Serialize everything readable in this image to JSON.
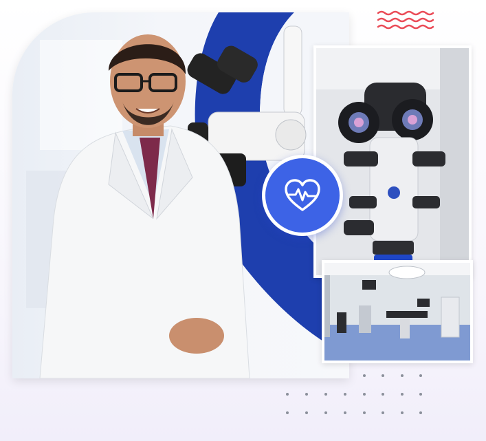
{
  "scene": {
    "subject": "doctor-portrait-collage",
    "colors": {
      "accent_blue": "#3d63e6",
      "deep_blue": "#1e3fae",
      "green": "#1fb58a",
      "wave_red": "#ea4b57",
      "dot_gray": "#8a8f9a"
    },
    "icons": [
      "heart-pulse-icon",
      "wave-decoration",
      "dot-grid"
    ],
    "photos": {
      "main": "doctor-with-microscope",
      "microscope": "microscope-closeup",
      "operating_room": "operating-room"
    }
  }
}
